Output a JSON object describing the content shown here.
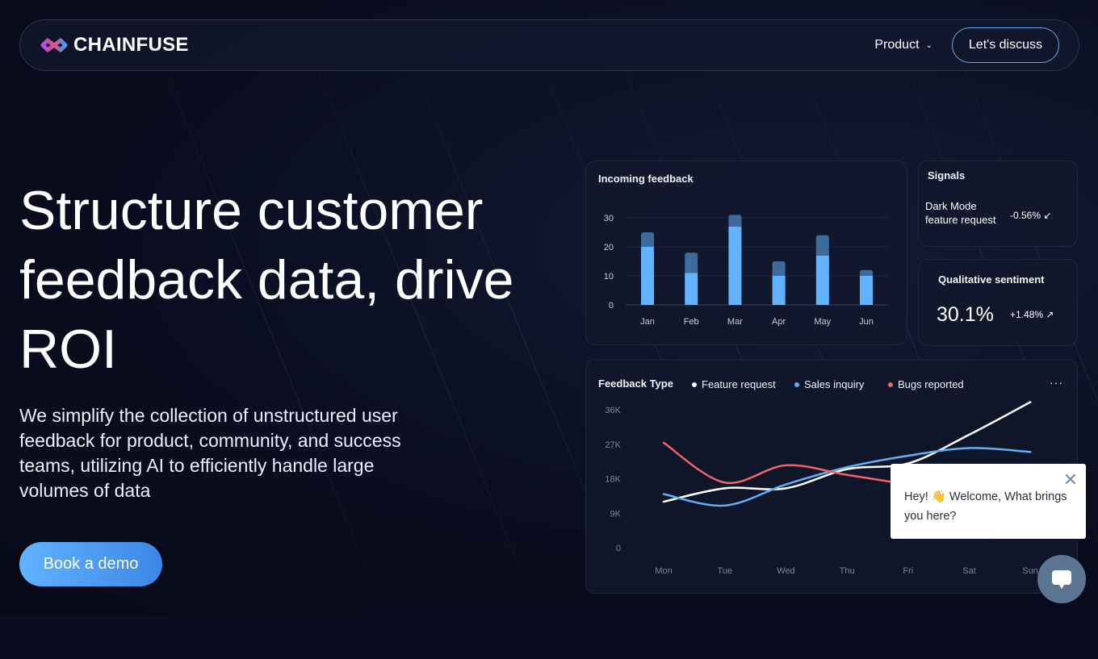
{
  "nav": {
    "brand": "CHAINFUSE",
    "product": "Product",
    "cta": "Let's discuss"
  },
  "hero": {
    "title": "Structure customer feedback data, drive ROI",
    "subtitle": "We simplify the collection of unstructured user feedback for product, community, and success teams, utilizing AI to efficiently handle large volumes of data",
    "button": "Book a demo"
  },
  "signals": {
    "title": "Signals",
    "item_line1": "Dark Mode",
    "item_line2": "feature request",
    "change": "-0.56%"
  },
  "sentiment": {
    "title": "Qualitative sentiment",
    "value": "30.1%",
    "change": "+1.48%"
  },
  "popup": {
    "text": "Hey! 👋 Welcome, What brings you here?"
  },
  "colors": {
    "accent": "#62b3ff",
    "feature": "#ffffff",
    "sales": "#62aef5",
    "bugs": "#f0636b"
  },
  "chart_data": [
    {
      "type": "bar",
      "title": "Incoming feedback",
      "categories": [
        "Jan",
        "Feb",
        "Mar",
        "Apr",
        "May",
        "Jun"
      ],
      "series": [
        {
          "values": [
            20,
            11,
            27,
            10,
            17,
            10
          ]
        },
        {
          "values": [
            5,
            7,
            4,
            5,
            7,
            2
          ]
        }
      ],
      "stacked": true,
      "ylim": [
        0,
        30
      ],
      "yticks": [
        "0",
        "10",
        "20",
        "30"
      ],
      "grid": true
    },
    {
      "type": "line",
      "title": "Feedback Type",
      "categories": [
        "Mon",
        "Tue",
        "Wed",
        "Thu",
        "Fri",
        "Sat",
        "Sun"
      ],
      "ylim": [
        0,
        36000
      ],
      "yticks": [
        "0",
        "9K",
        "18K",
        "27K",
        "36K"
      ],
      "series": [
        {
          "name": "Feature request",
          "values": [
            12000,
            15500,
            15500,
            20500,
            22000,
            29500,
            38000
          ]
        },
        {
          "name": "Sales inquiry",
          "values": [
            14000,
            11000,
            16500,
            21000,
            24000,
            26000,
            25000
          ]
        },
        {
          "name": "Bugs reported",
          "values": [
            27400,
            17000,
            21500,
            19000,
            16500
          ]
        }
      ],
      "legend": "top"
    }
  ]
}
